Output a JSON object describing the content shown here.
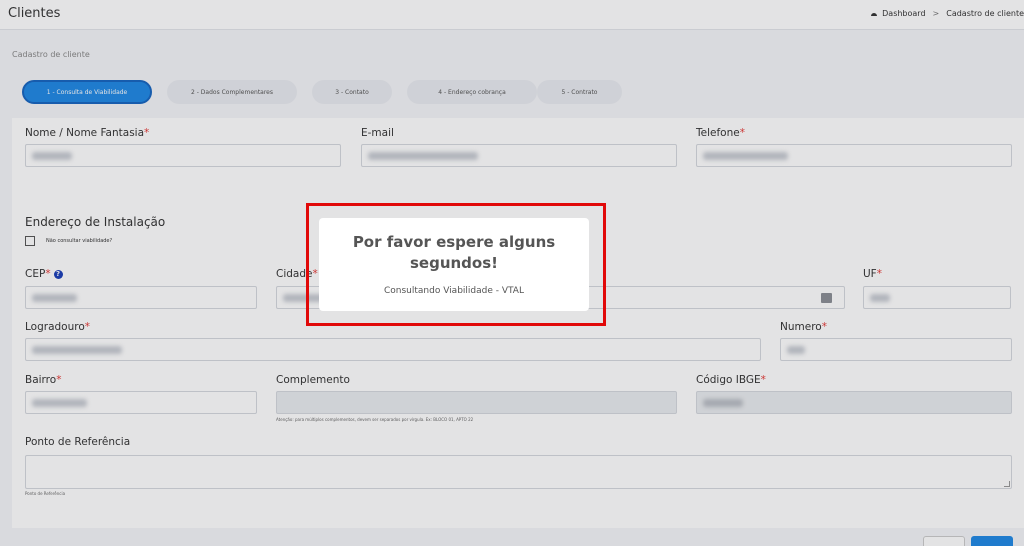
{
  "header": {
    "title": "Clientes",
    "breadcrumb": [
      "Dashboard",
      "Cadastro de cliente"
    ],
    "home_icon": "dashboard-icon"
  },
  "form": {
    "section_title": "Cadastro de cliente",
    "steps": [
      {
        "label": "1 - Consulta de Viabilidade",
        "active": true
      },
      {
        "label": "2 - Dados Complementares",
        "active": false
      },
      {
        "label": "3 - Contato",
        "active": false
      },
      {
        "label": "4 - Endereço cobrança",
        "active": false
      },
      {
        "label": "5 - Contrato",
        "active": false
      }
    ],
    "labels": {
      "nome": "Nome / Nome Fantasia",
      "email": "E-mail",
      "telefone": "Telefone",
      "endereco_instalacao": "Endereço de Instalação",
      "nao_consultar": "Não consultar viabilidade?",
      "cep": "CEP",
      "cidade": "Cidade",
      "uf": "UF",
      "logradouro": "Logradouro",
      "numero": "Numero",
      "bairro": "Bairro",
      "complemento": "Complemento",
      "codigo_ibge": "Código IBGE",
      "ponto_referencia": "Ponto de Referência"
    },
    "required_mark": "*",
    "hints": {
      "complemento": "Atenção: para múltiplos complementos, devem ser separados por vírgula. Ex: BLOCO 01, APTO 22",
      "ponto_referencia": "Ponto de Referência"
    }
  },
  "modal": {
    "title": "Por favor espere alguns segundos!",
    "subtitle": "Consultando Viabilidade - VTAL",
    "highlight_color": "#e10909"
  },
  "colors": {
    "accent": "#1e88e5",
    "required": "#e53935"
  }
}
